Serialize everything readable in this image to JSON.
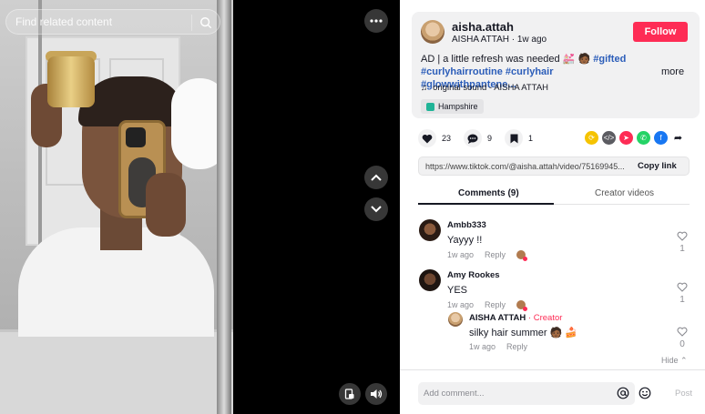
{
  "search": {
    "placeholder": "Find related content"
  },
  "author": {
    "username": "aisha.attah",
    "display_name": "AISHA ATTAH",
    "time": "1w ago",
    "follow_label": "Follow"
  },
  "post": {
    "desc_text": "AD | a little refresh was needed 💒 🧑🏾",
    "tag1": "#gifted",
    "tag2": "#curlyhairroutine",
    "tag3": "#curlyhair",
    "tag4": "#glowwithpantene...",
    "more_label": "more",
    "sound": "original sound - AISHA ATTAH",
    "location": "Hampshire"
  },
  "stats": {
    "likes": "23",
    "comments": "9",
    "saves": "1"
  },
  "share": {
    "url": "https://www.tiktok.com/@aisha.attah/video/75169945...",
    "copy_label": "Copy link"
  },
  "tabs": {
    "comments": "Comments (9)",
    "creator_videos": "Creator videos"
  },
  "comments": [
    {
      "name": "Ambb333",
      "text": "Yayyy !!",
      "time": "1w ago",
      "reply": "Reply",
      "likes": "1"
    },
    {
      "name": "Amy Rookes",
      "text": "YES",
      "time": "1w ago",
      "reply": "Reply",
      "likes": "1"
    },
    {
      "name": "AISHA ATTAH",
      "creator": "· Creator",
      "text": "silky hair summer 🧑🏾 🍰",
      "time": "1w ago",
      "reply": "Reply",
      "likes": "0"
    }
  ],
  "hide_label": "Hide",
  "composer": {
    "placeholder": "Add comment...",
    "post_label": "Post"
  },
  "colors": {
    "accent": "#fe2c55",
    "hashtag": "#2b5db9"
  }
}
